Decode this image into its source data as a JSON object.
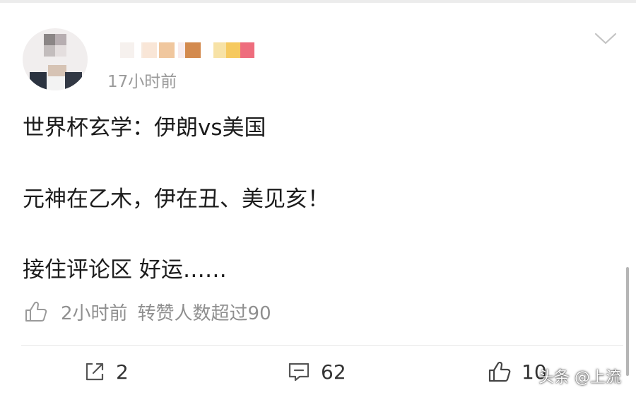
{
  "post": {
    "time_ago": "17小时前",
    "lines": [
      "世界杯玄学：伊朗vs美国",
      "元神在乙木，伊在丑、美见亥！",
      "接住评论区 好运……"
    ]
  },
  "meta": {
    "time": "2小时前",
    "text": "转赞人数超过90"
  },
  "actions": {
    "repost_count": "2",
    "comment_count": "62",
    "like_count": "10"
  },
  "watermark": "头条 @上流",
  "icons": {
    "menu": "chevron-down-icon",
    "meta_like": "thumbs-up-icon",
    "repost": "share-icon",
    "comment": "comment-icon",
    "like": "thumbs-up-icon"
  },
  "colors": {
    "text": "#1c1c1c",
    "muted": "#9a9a9a",
    "divider": "#e6e6e6"
  }
}
